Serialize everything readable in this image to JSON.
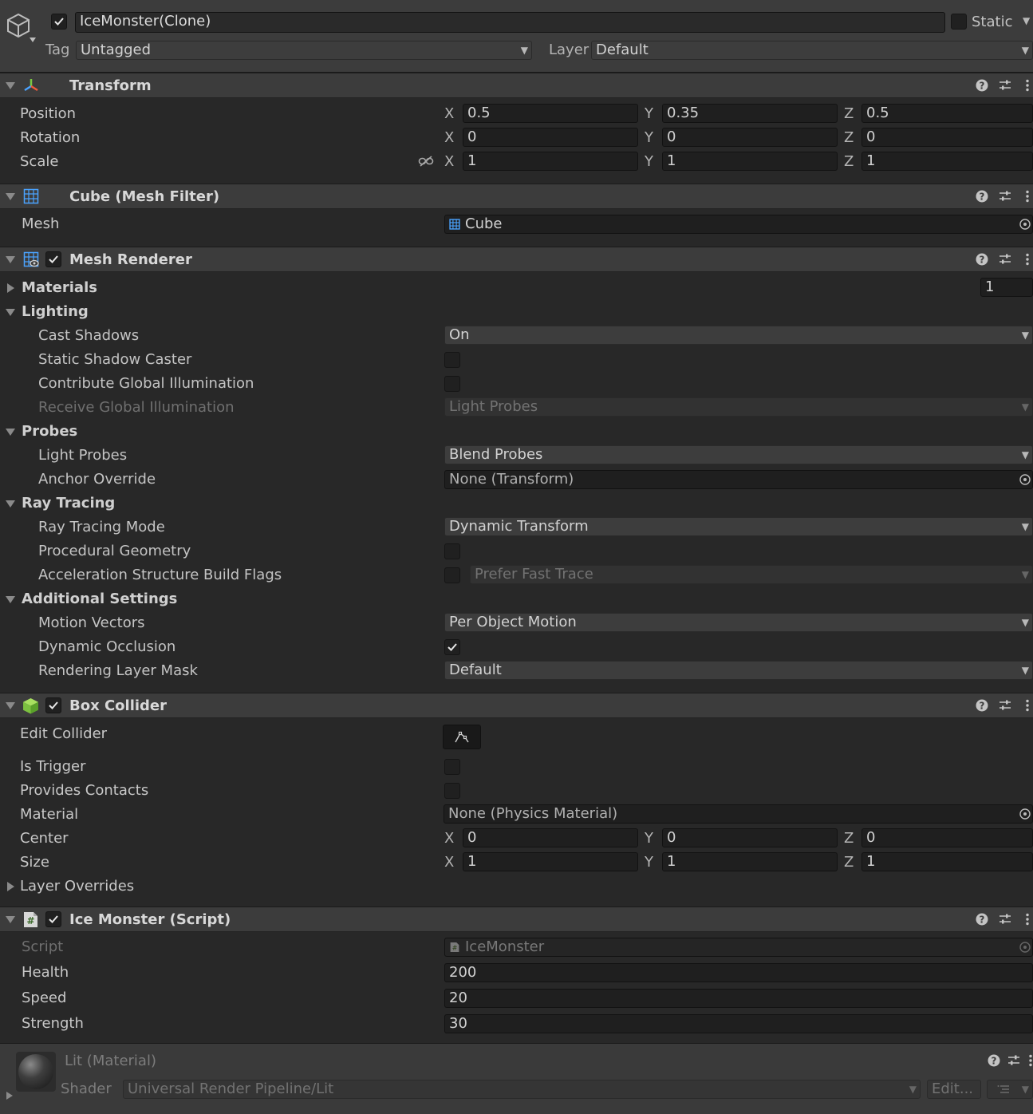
{
  "gameobject": {
    "name": "IceMonster(Clone)",
    "static_label": "Static",
    "tag_label": "Tag",
    "tag_value": "Untagged",
    "layer_label": "Layer",
    "layer_value": "Default"
  },
  "transform": {
    "title": "Transform",
    "position_label": "Position",
    "rotation_label": "Rotation",
    "scale_label": "Scale",
    "axis_x": "X",
    "axis_y": "Y",
    "axis_z": "Z",
    "position": {
      "x": "0.5",
      "y": "0.35",
      "z": "0.5"
    },
    "rotation": {
      "x": "0",
      "y": "0",
      "z": "0"
    },
    "scale": {
      "x": "1",
      "y": "1",
      "z": "1"
    }
  },
  "mesh_filter": {
    "title": "Cube (Mesh Filter)",
    "mesh_label": "Mesh",
    "mesh_value": "Cube"
  },
  "mesh_renderer": {
    "title": "Mesh Renderer",
    "materials_label": "Materials",
    "materials_count": "1",
    "lighting_label": "Lighting",
    "cast_shadows_label": "Cast Shadows",
    "cast_shadows_value": "On",
    "static_shadow_caster_label": "Static Shadow Caster",
    "contribute_gi_label": "Contribute Global Illumination",
    "receive_gi_label": "Receive Global Illumination",
    "receive_gi_value": "Light Probes",
    "probes_label": "Probes",
    "light_probes_label": "Light Probes",
    "light_probes_value": "Blend Probes",
    "anchor_override_label": "Anchor Override",
    "anchor_override_value": "None (Transform)",
    "ray_tracing_label": "Ray Tracing",
    "ray_tracing_mode_label": "Ray Tracing Mode",
    "ray_tracing_mode_value": "Dynamic Transform",
    "procedural_geometry_label": "Procedural Geometry",
    "accel_flags_label": "Acceleration Structure Build Flags",
    "accel_flags_value": "Prefer Fast Trace",
    "additional_settings_label": "Additional Settings",
    "motion_vectors_label": "Motion Vectors",
    "motion_vectors_value": "Per Object Motion",
    "dynamic_occlusion_label": "Dynamic Occlusion",
    "rendering_layer_mask_label": "Rendering Layer Mask",
    "rendering_layer_mask_value": "Default"
  },
  "box_collider": {
    "title": "Box Collider",
    "edit_collider_label": "Edit Collider",
    "is_trigger_label": "Is Trigger",
    "provides_contacts_label": "Provides Contacts",
    "material_label": "Material",
    "material_value": "None (Physics Material)",
    "center_label": "Center",
    "size_label": "Size",
    "center": {
      "x": "0",
      "y": "0",
      "z": "0"
    },
    "size": {
      "x": "1",
      "y": "1",
      "z": "1"
    },
    "layer_overrides_label": "Layer Overrides"
  },
  "script": {
    "title": "Ice Monster (Script)",
    "script_label": "Script",
    "script_value": "IceMonster",
    "health_label": "Health",
    "health_value": "200",
    "speed_label": "Speed",
    "speed_value": "20",
    "strength_label": "Strength",
    "strength_value": "30"
  },
  "material": {
    "title": "Lit (Material)",
    "shader_label": "Shader",
    "shader_value": "Universal Render Pipeline/Lit",
    "edit_label": "Edit..."
  },
  "icons": [
    "cube-icon",
    "transform-icon",
    "mesh-filter-icon",
    "mesh-renderer-icon",
    "box-collider-icon",
    "script-icon",
    "help-icon",
    "presets-icon",
    "more-icon",
    "target-icon",
    "link-icon",
    "edit-collider-icon",
    "material-sphere-icon"
  ]
}
